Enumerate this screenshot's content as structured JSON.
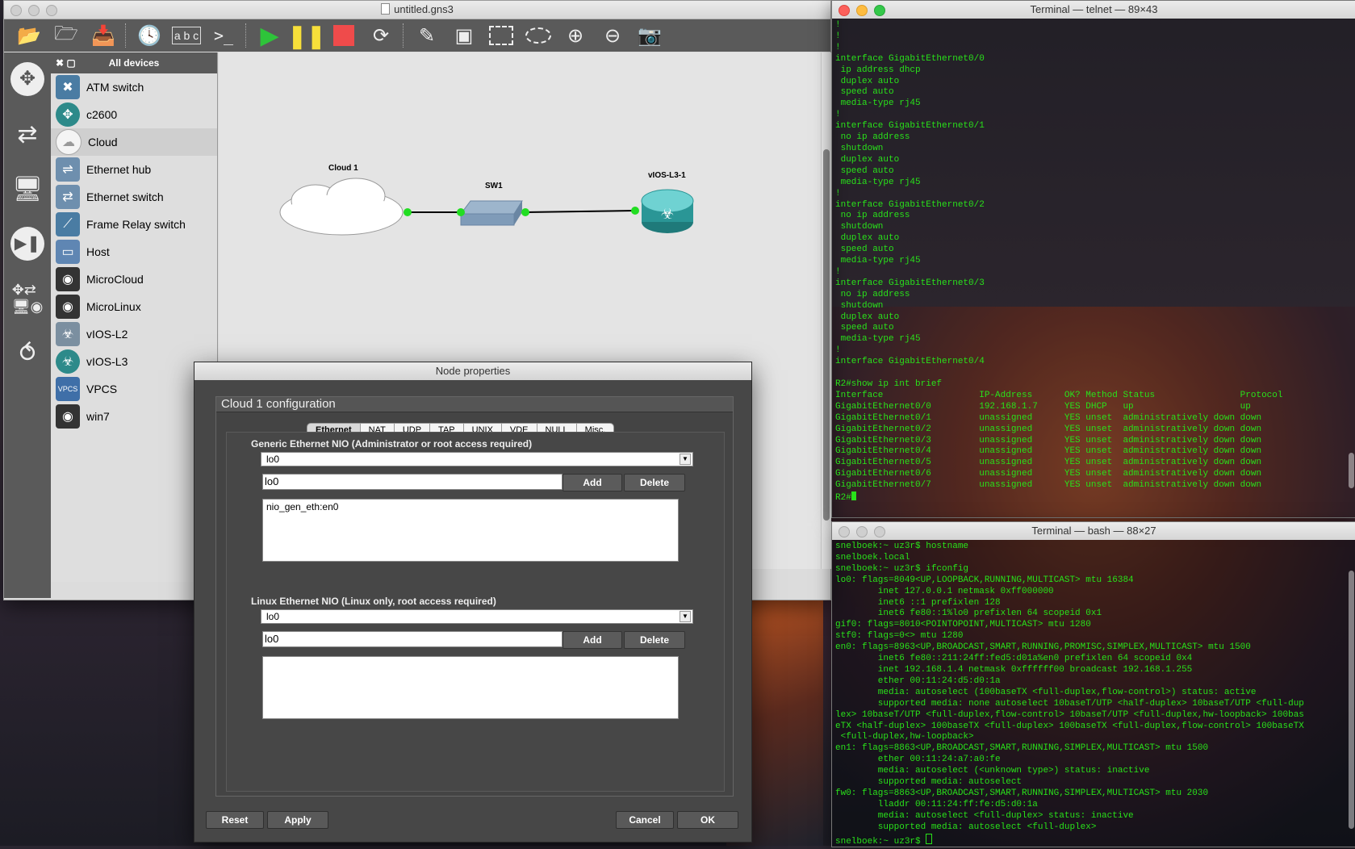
{
  "gns": {
    "title": "untitled.gns3",
    "panel_header": "All devices",
    "devices": [
      {
        "label": "ATM switch",
        "icon": "atm-switch-icon"
      },
      {
        "label": "c2600",
        "icon": "router-icon"
      },
      {
        "label": "Cloud",
        "icon": "cloud-icon"
      },
      {
        "label": "Ethernet hub",
        "icon": "ethernet-hub-icon"
      },
      {
        "label": "Ethernet switch",
        "icon": "ethernet-switch-icon"
      },
      {
        "label": "Frame Relay switch",
        "icon": "frame-relay-switch-icon"
      },
      {
        "label": "Host",
        "icon": "host-icon"
      },
      {
        "label": "MicroCloud",
        "icon": "microcloud-icon"
      },
      {
        "label": "MicroLinux",
        "icon": "microlinux-icon"
      },
      {
        "label": "vIOS-L2",
        "icon": "vios-l2-icon"
      },
      {
        "label": "vIOS-L3",
        "icon": "vios-l3-icon"
      },
      {
        "label": "VPCS",
        "icon": "vpcs-icon"
      },
      {
        "label": "win7",
        "icon": "win7-icon"
      }
    ],
    "topology": {
      "cloud_label": "Cloud 1",
      "switch_label": "SW1",
      "router_label": "vIOS-L3-1"
    }
  },
  "dialog": {
    "title": "Node properties",
    "config_title": "Cloud 1 configuration",
    "tabs": [
      "Ethernet",
      "NAT",
      "UDP",
      "TAP",
      "UNIX",
      "VDE",
      "NULL",
      "Misc."
    ],
    "generic": {
      "label": "Generic Ethernet NIO (Administrator or root access required)",
      "combo_value": "lo0",
      "text_value": "lo0",
      "list": [
        "nio_gen_eth:en0"
      ]
    },
    "linux": {
      "label": "Linux Ethernet NIO (Linux only, root access required)",
      "combo_value": "lo0",
      "text_value": "lo0"
    },
    "add_label": "Add",
    "delete_label": "Delete",
    "reset_label": "Reset",
    "apply_label": "Apply",
    "cancel_label": "Cancel",
    "ok_label": "OK"
  },
  "term1": {
    "title": "Terminal — telnet — 89×43",
    "text": "!\n!\n!\ninterface GigabitEthernet0/0\n ip address dhcp\n duplex auto\n speed auto\n media-type rj45\n!\ninterface GigabitEthernet0/1\n no ip address\n shutdown\n duplex auto\n speed auto\n media-type rj45\n!\ninterface GigabitEthernet0/2\n no ip address\n shutdown\n duplex auto\n speed auto\n media-type rj45\n!\ninterface GigabitEthernet0/3\n no ip address\n shutdown\n duplex auto\n speed auto\n media-type rj45\n!\ninterface GigabitEthernet0/4\n\nR2#show ip int brief\nInterface                  IP-Address      OK? Method Status                Protocol\nGigabitEthernet0/0         192.168.1.7     YES DHCP   up                    up\nGigabitEthernet0/1         unassigned      YES unset  administratively down down\nGigabitEthernet0/2         unassigned      YES unset  administratively down down\nGigabitEthernet0/3         unassigned      YES unset  administratively down down\nGigabitEthernet0/4         unassigned      YES unset  administratively down down\nGigabitEthernet0/5         unassigned      YES unset  administratively down down\nGigabitEthernet0/6         unassigned      YES unset  administratively down down\nGigabitEthernet0/7         unassigned      YES unset  administratively down down\nR2#"
  },
  "term2": {
    "title": "Terminal — bash — 88×27",
    "text": "snelboek:~ uz3r$ hostname\nsnelboek.local\nsnelboek:~ uz3r$ ifconfig\nlo0: flags=8049<UP,LOOPBACK,RUNNING,MULTICAST> mtu 16384\n        inet 127.0.0.1 netmask 0xff000000\n        inet6 ::1 prefixlen 128\n        inet6 fe80::1%lo0 prefixlen 64 scopeid 0x1\ngif0: flags=8010<POINTOPOINT,MULTICAST> mtu 1280\nstf0: flags=0<> mtu 1280\nen0: flags=8963<UP,BROADCAST,SMART,RUNNING,PROMISC,SIMPLEX,MULTICAST> mtu 1500\n        inet6 fe80::211:24ff:fed5:d01a%en0 prefixlen 64 scopeid 0x4\n        inet 192.168.1.4 netmask 0xffffff00 broadcast 192.168.1.255\n        ether 00:11:24:d5:d0:1a\n        media: autoselect (100baseTX <full-duplex,flow-control>) status: active\n        supported media: none autoselect 10baseT/UTP <half-duplex> 10baseT/UTP <full-dup\nlex> 10baseT/UTP <full-duplex,flow-control> 10baseT/UTP <full-duplex,hw-loopback> 100bas\neTX <half-duplex> 100baseTX <full-duplex> 100baseTX <full-duplex,flow-control> 100baseTX\n <full-duplex,hw-loopback>\nen1: flags=8863<UP,BROADCAST,SMART,RUNNING,SIMPLEX,MULTICAST> mtu 1500\n        ether 00:11:24:a7:a0:fe\n        media: autoselect (<unknown type>) status: inactive\n        supported media: autoselect\nfw0: flags=8863<UP,BROADCAST,SMART,RUNNING,SIMPLEX,MULTICAST> mtu 2030\n        lladdr 00:11:24:ff:fe:d5:d0:1a\n        media: autoselect <full-duplex> status: inactive\n        supported media: autoselect <full-duplex>\nsnelboek:~ uz3r$ "
  }
}
